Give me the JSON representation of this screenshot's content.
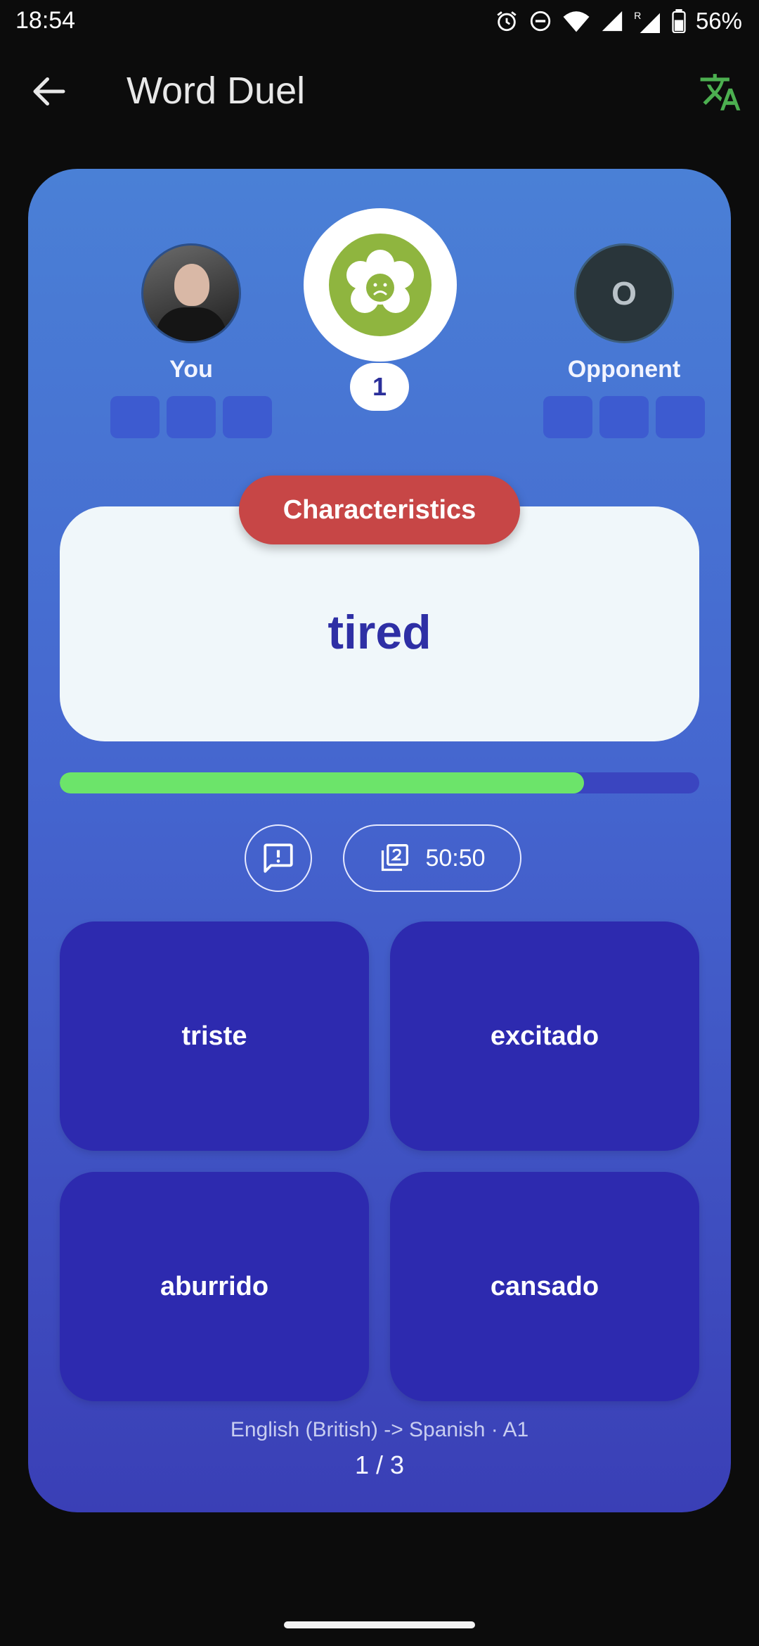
{
  "status_bar": {
    "time": "18:54",
    "battery": "56%"
  },
  "app_bar": {
    "title": "Word Duel"
  },
  "players": {
    "you": {
      "name": "You"
    },
    "opponent": {
      "name": "Opponent",
      "initial": "O"
    }
  },
  "round": {
    "number": "1",
    "emblem_icon": "sad-face-cloud-icon"
  },
  "question": {
    "category": "Characteristics",
    "word": "tired"
  },
  "timer": {
    "progress": 0.82
  },
  "actions": {
    "fifty_fifty": "50:50"
  },
  "answers": [
    "triste",
    "excitado",
    "aburrido",
    "cansado"
  ],
  "footer": {
    "language_pair": "English (British) -> Spanish · A1",
    "progress": "1 / 3"
  },
  "colors": {
    "category": "#c74646",
    "answer_bg": "#2d2aaf",
    "progress": "#6ce46a",
    "emblem": "#8fb53f",
    "translate_icon": "#4caf50"
  }
}
